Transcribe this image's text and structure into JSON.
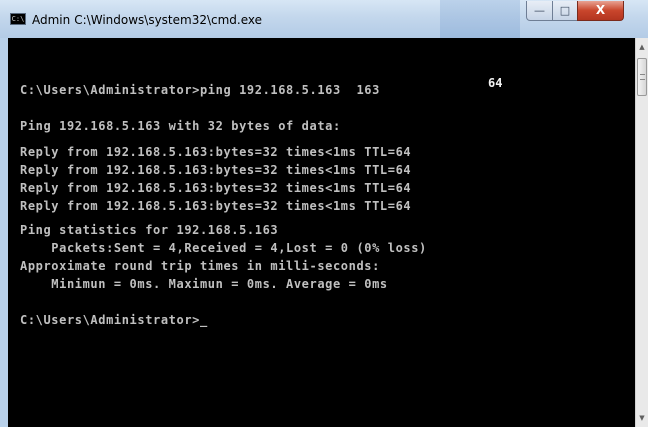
{
  "window": {
    "title_user": "Admin",
    "title_path": "C:\\Windows\\system32\\cmd.exe",
    "icon": "cmd-icon",
    "icon_label": "C:\\",
    "controls": {
      "minimize": "—",
      "maximize": "□",
      "close": "X"
    }
  },
  "console": {
    "floating_text": "64",
    "lines": [
      "C:\\Users\\Administrator>ping 192.168.5.163  163",
      "Ping 192.168.5.163 with 32 bytes of data:",
      "Reply from 192.168.5.163:bytes=32 times<1ms TTL=64",
      "Reply from 192.168.5.163:bytes=32 times<1ms TTL=64",
      "Reply from 192.168.5.163:bytes=32 times<1ms TTL=64",
      "Reply from 192.168.5.163:bytes=32 times<1ms TTL=64",
      "Ping statistics for 192.168.5.163",
      "    Packets:Sent = 4,Received = 4,Lost = 0 (0% loss)",
      "Approximate round trip times in milli-seconds:",
      "    Minimun = 0ms. Maximun = 0ms. Average = 0ms",
      "C:\\Users\\Administrator>_"
    ]
  },
  "scrollbar": {
    "up_arrow": "▲",
    "down_arrow": "▼"
  },
  "colors": {
    "console_bg": "#000000",
    "console_text": "#c0c0c0",
    "titlebar": "#c3d7ec",
    "close_button": "#c9462c"
  }
}
